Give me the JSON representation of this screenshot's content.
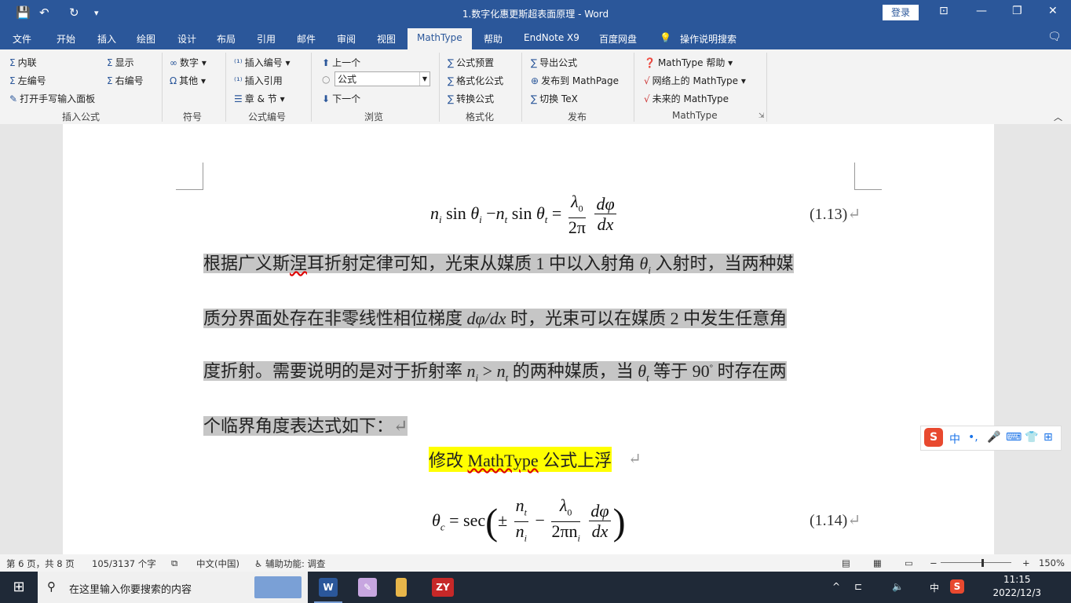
{
  "window": {
    "title": "1.数字化惠更斯超表面原理  -  Word",
    "login": "登录",
    "quick_access": {
      "save": "💾",
      "undo": "↶",
      "redo": "↻",
      "more": "▾"
    },
    "controls": {
      "ribbon_display": "⊡",
      "minimize": "—",
      "maximize": "❐",
      "close": "✕"
    }
  },
  "tabs": [
    "文件",
    "开始",
    "插入",
    "绘图",
    "设计",
    "布局",
    "引用",
    "邮件",
    "审阅",
    "视图",
    "MathType",
    "帮助",
    "EndNote X9",
    "百度网盘"
  ],
  "tell_me": "操作说明搜索",
  "ribbon": {
    "insert_equation": {
      "inline": "内联",
      "left_numbered": "左编号",
      "handwriting": "打开手写输入面板",
      "display": "显示",
      "right_numbered": "右编号",
      "group": "插入公式"
    },
    "symbols": {
      "numbers": "数字",
      "other": "其他",
      "group": "符号"
    },
    "numbering": {
      "insert_number": "插入编号",
      "insert_reference": "插入引用",
      "chapter_section": "章 & 节",
      "group": "公式编号"
    },
    "browse": {
      "prev": "上一个",
      "combo": "公式",
      "next": "下一个",
      "group": "浏览"
    },
    "format": {
      "preset": "公式预置",
      "format_eq": "格式化公式",
      "convert": "转换公式",
      "group": "格式化"
    },
    "publish": {
      "export": "导出公式",
      "mathpage": "发布到 MathPage",
      "tex": "切换 TeX",
      "group": "发布"
    },
    "mathtype": {
      "help": "MathType 帮助",
      "web": "网络上的 MathType",
      "future": "未来的 MathType",
      "group": "MathType"
    }
  },
  "document": {
    "eq_113": {
      "lhs": "n",
      "sub_i": "i",
      "sin": "sin",
      "theta": "θ",
      "minus": "−",
      "sub_t": "t",
      "equals": "=",
      "num1": "λ",
      "num1_sub": "0",
      "den1": "2π",
      "num2": "dφ",
      "den2": "dx",
      "number": "(1.13)",
      "mark": "↵"
    },
    "para_lines": [
      {
        "before": "根据广义斯涅耳折射定律可知，光束从媒质 1 中以入射角 ",
        "sym": "θ",
        "sub": "i",
        "after": " 入射时，当两种媒"
      },
      {
        "before": "质分界面处存在非零线性相位梯度 ",
        "sym": "dφ/dx",
        "sub": "",
        "after": " 时，光束可以在媒质 2 中发生任意角"
      },
      {
        "before": "度折射。需要说明的是对于折射率 ",
        "sym": "n",
        "sub": "i",
        "after": " 的两种媒质，当 "
      },
      {
        "before": "个临界角度表达式如下：",
        "sym": "",
        "sub": "",
        "after": "↵"
      }
    ],
    "ineq": {
      "gt": ">",
      "n": "n",
      "sub": "t"
    },
    "theta_t": {
      "sym": "θ",
      "sub": "t",
      "text": " 等于 90",
      "deg": "°",
      "rest": " 时存在两"
    },
    "squiggle_word": "涅",
    "highlight_note": {
      "pre": "修改 ",
      "word": "MathType",
      "post": " 公式上浮",
      "mark": "↵"
    },
    "eq_114": {
      "theta": "θ",
      "sub_c": "c",
      "equals": "=",
      "sec": "sec",
      "pm": "±",
      "n": "n",
      "sub_t": "t",
      "sub_i": "i",
      "minus": "−",
      "lam": "λ",
      "lam_sub": "0",
      "den": "2πn",
      "dphi": "dφ",
      "dx": "dx",
      "number": "(1.14)",
      "mark": "↵"
    }
  },
  "ime": {
    "logo": "S",
    "items": [
      "中",
      "•,",
      "🎤",
      "⌨",
      "👕",
      "⊞"
    ]
  },
  "status": {
    "page": "第 6 页，共 8 页",
    "words": "105/3137 个字",
    "lang": "中文(中国)",
    "access": "辅助功能: 调查",
    "zoom": "150%",
    "zoom_minus": "−",
    "zoom_plus": "+"
  },
  "taskbar": {
    "search": "在这里输入你要搜索的内容",
    "time": "11:15",
    "date": "2022/12/3",
    "start": "⊞",
    "search_icon": "⚲",
    "apps": [
      "W",
      "ZY"
    ],
    "tray": [
      "^",
      "⊏",
      "🔈",
      "中",
      "S"
    ]
  }
}
